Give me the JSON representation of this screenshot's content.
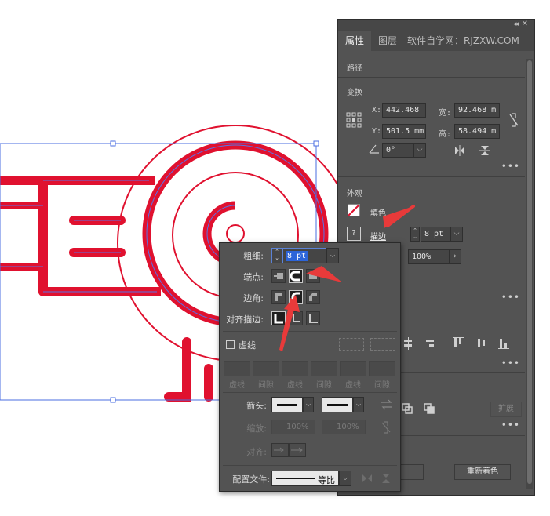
{
  "properties_panel": {
    "tabs": [
      {
        "label": "属性"
      },
      {
        "label": "图层"
      },
      {
        "label": "软件自学网：RJZXW.COM"
      }
    ],
    "path_title": "路径",
    "transform": {
      "title": "变换",
      "x_label": "X:",
      "x_value": "442.468",
      "y_label": "Y:",
      "y_value": "501.5 mm",
      "w_label": "宽:",
      "w_value": "92.468 m",
      "h_label": "高:",
      "h_value": "58.494 m",
      "angle_value": "0°"
    },
    "appearance": {
      "title": "外观",
      "fill_label": "填色",
      "stroke_label": "描边",
      "stroke_value": "8 pt",
      "opacity_value": "100%"
    },
    "recolor_button": "重新着色",
    "expand_button": "扩展"
  },
  "stroke_panel": {
    "weight_label": "粗细:",
    "weight_value": "8 pt",
    "cap_label": "端点:",
    "corner_label": "边角:",
    "align_label": "对齐描边:",
    "dashed_label": "虚线",
    "dash_labels": [
      "虚线",
      "间隙",
      "虚线",
      "间隙",
      "虚线",
      "间隙"
    ],
    "arrowheads_label": "箭头:",
    "scale_label": "缩放:",
    "scale_start": "100%",
    "scale_end": "100%",
    "align_arrow_label": "对齐:",
    "profile_label": "配置文件:",
    "profile_value": "等比"
  },
  "colors": {
    "artwork_red": "#e0112f",
    "selection_blue": "#4a6de0",
    "panel_bg": "#535353",
    "annotation_arrow": "#e83a3a"
  }
}
